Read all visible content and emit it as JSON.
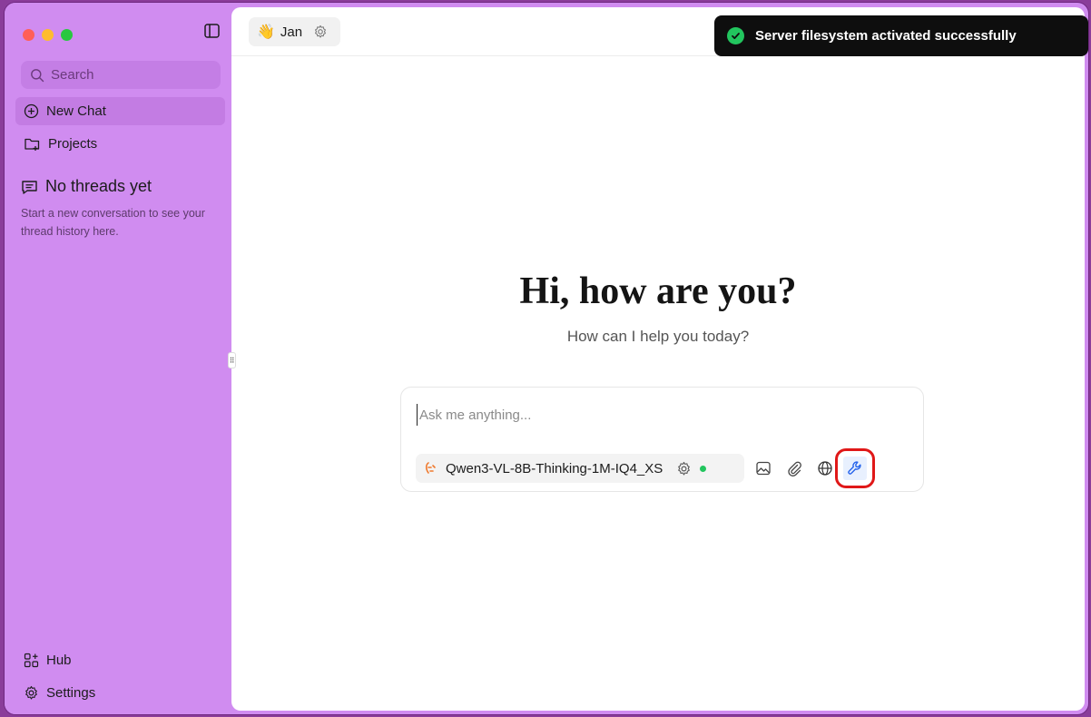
{
  "sidebar": {
    "search_placeholder": "Search",
    "new_chat": "New Chat",
    "projects": "Projects",
    "empty_title": "No threads yet",
    "empty_desc": "Start a new conversation to see your thread history here.",
    "hub": "Hub",
    "settings": "Settings"
  },
  "header": {
    "assistant_name": "Jan",
    "assistant_emoji": "👋"
  },
  "main": {
    "greeting": "Hi, how are you?",
    "subgreeting": "How can I help you today?"
  },
  "composer": {
    "placeholder": "Ask me anything...",
    "model_name": "Qwen3-VL-8B-Thinking-1M-IQ4_XS",
    "model_status": "active"
  },
  "toast": {
    "message": "Server filesystem activated successfully"
  },
  "colors": {
    "sidebar_bg": "#d08cf0",
    "accent_green": "#22c55e",
    "highlight_red": "#e01818",
    "model_icon": "#f07a2e"
  },
  "icons": {
    "sidebar_toggle": "panel-left-icon",
    "search": "search-icon",
    "new_chat": "plus-circle-icon",
    "projects": "folder-plus-icon",
    "threads": "message-square-icon",
    "hub": "grid-plus-icon",
    "settings": "gear-icon",
    "image": "image-icon",
    "attach": "paperclip-icon",
    "web": "globe-icon",
    "tools": "wrench-icon"
  }
}
